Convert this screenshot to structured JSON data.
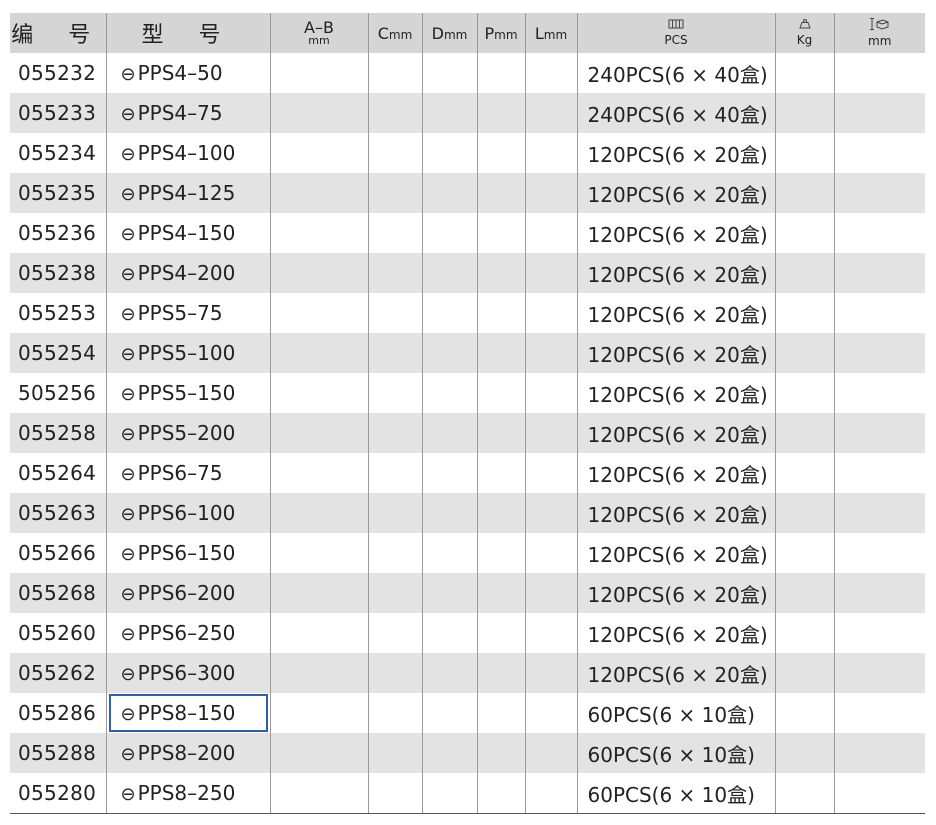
{
  "headers": {
    "code": "编 号",
    "model": "型 号",
    "ab_main": "A–B",
    "ab_unit": "mm",
    "c": "C",
    "d": "D",
    "p": "P",
    "l": "L",
    "unit_mm": "mm",
    "pcs": "PCS",
    "kg": "Kg",
    "size_mm": "mm"
  },
  "icons": [
    "box-stack-icon",
    "weight-icon",
    "dimension-box-icon"
  ],
  "highlight_color": "#2e5fb3",
  "rows": [
    {
      "code": "055232",
      "model_symbol": "⊖",
      "model": "PPS4–50",
      "pack": "240PCS(6 × 40盒)"
    },
    {
      "code": "055233",
      "model_symbol": "⊖",
      "model": "PPS4–75",
      "pack": "240PCS(6 × 40盒)"
    },
    {
      "code": "055234",
      "model_symbol": "⊖",
      "model": "PPS4–100",
      "pack": "120PCS(6 × 20盒)"
    },
    {
      "code": "055235",
      "model_symbol": "⊖",
      "model": "PPS4–125",
      "pack": "120PCS(6 × 20盒)"
    },
    {
      "code": "055236",
      "model_symbol": "⊖",
      "model": "PPS4–150",
      "pack": "120PCS(6 × 20盒)"
    },
    {
      "code": "055238",
      "model_symbol": "⊖",
      "model": "PPS4–200",
      "pack": "120PCS(6 × 20盒)"
    },
    {
      "code": "055253",
      "model_symbol": "⊖",
      "model": "PPS5–75",
      "pack": "120PCS(6 × 20盒)"
    },
    {
      "code": "055254",
      "model_symbol": "⊖",
      "model": "PPS5–100",
      "pack": "120PCS(6 × 20盒)"
    },
    {
      "code": "505256",
      "model_symbol": "⊖",
      "model": "PPS5–150",
      "pack": "120PCS(6 × 20盒)"
    },
    {
      "code": "055258",
      "model_symbol": "⊖",
      "model": "PPS5–200",
      "pack": "120PCS(6 × 20盒)"
    },
    {
      "code": "055264",
      "model_symbol": "⊖",
      "model": "PPS6–75",
      "pack": "120PCS(6 × 20盒)"
    },
    {
      "code": "055263",
      "model_symbol": "⊖",
      "model": "PPS6–100",
      "pack": "120PCS(6 × 20盒)"
    },
    {
      "code": "055266",
      "model_symbol": "⊖",
      "model": "PPS6–150",
      "pack": "120PCS(6 × 20盒)"
    },
    {
      "code": "055268",
      "model_symbol": "⊖",
      "model": "PPS6–200",
      "pack": "120PCS(6 × 20盒)"
    },
    {
      "code": "055260",
      "model_symbol": "⊖",
      "model": "PPS6–250",
      "pack": "120PCS(6 × 20盒)"
    },
    {
      "code": "055262",
      "model_symbol": "⊖",
      "model": "PPS6–300",
      "pack": "120PCS(6 × 20盒)"
    },
    {
      "code": "055286",
      "model_symbol": "⊖",
      "model": "PPS8–150",
      "pack": "60PCS(6 × 10盒)",
      "selected": true
    },
    {
      "code": "055288",
      "model_symbol": "⊖",
      "model": "PPS8–200",
      "pack": "60PCS(6 × 10盒)"
    },
    {
      "code": "055280",
      "model_symbol": "⊖",
      "model": "PPS8–250",
      "pack": "60PCS(6 × 10盒)"
    }
  ]
}
